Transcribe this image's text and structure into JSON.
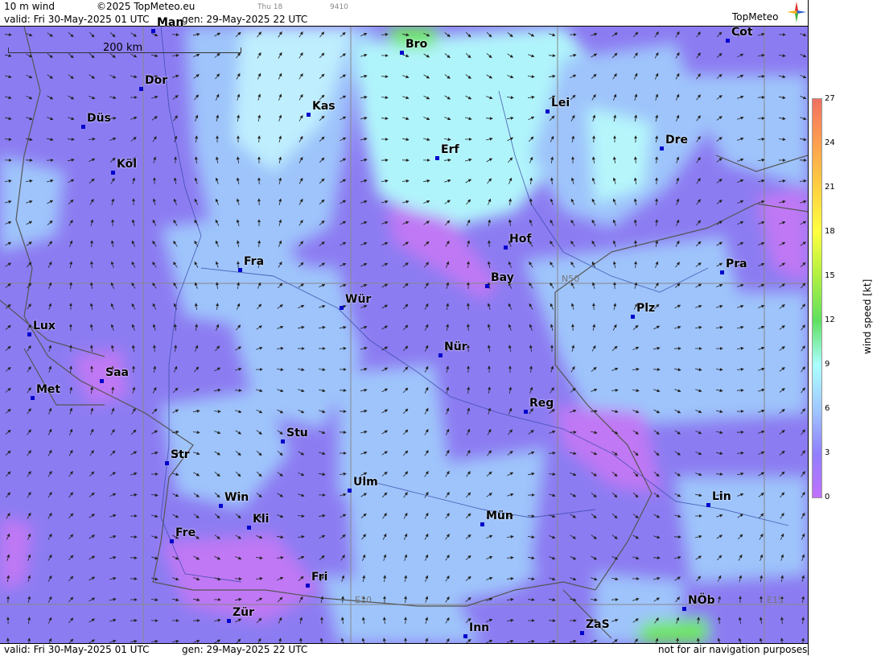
{
  "header": {
    "product": "10 m wind",
    "copyright": "©2025 TopMeteo.eu",
    "top_small_left": "Thu 18",
    "top_small_right": "9410",
    "valid_label": "valid:  Fri  30-May-2025  01 UTC",
    "gen_label": "gen: 29-May-2025 22 UTC",
    "brand": "TopMeteo"
  },
  "footer": {
    "valid_label": "valid:  Fri  30-May-2025  01 UTC",
    "gen_label": "gen: 29-May-2025 22 UTC",
    "disclaimer": "not for air navigation purposes"
  },
  "legend": {
    "title": "wind speed [kt]",
    "ticks": [
      "27",
      "24",
      "21",
      "18",
      "15",
      "12",
      "9",
      "6",
      "3",
      "0"
    ],
    "colors": [
      "#f07060",
      "#ffa050",
      "#ffd040",
      "#ffff40",
      "#b0f040",
      "#60e060",
      "#aaffff",
      "#a0c8ff",
      "#9080ff",
      "#c070ff"
    ]
  },
  "map": {
    "scale_label": "200 km",
    "grid_labels": [
      "N50",
      "E10",
      "E15"
    ],
    "cities": [
      {
        "name": "Man",
        "dot": [
          190,
          38
        ]
      },
      {
        "name": "Bro",
        "dot": [
          499,
          65
        ]
      },
      {
        "name": "Cot",
        "dot": [
          904,
          50
        ]
      },
      {
        "name": "Dor",
        "dot": [
          175,
          110
        ]
      },
      {
        "name": "Kas",
        "dot": [
          383,
          142
        ]
      },
      {
        "name": "Lei",
        "dot": [
          680,
          138
        ]
      },
      {
        "name": "Düs",
        "dot": [
          103,
          157
        ]
      },
      {
        "name": "Erf",
        "dot": [
          543,
          196
        ]
      },
      {
        "name": "Dre",
        "dot": [
          822,
          184
        ]
      },
      {
        "name": "Köl",
        "dot": [
          140,
          214
        ]
      },
      {
        "name": "Hof",
        "dot": [
          628,
          307
        ]
      },
      {
        "name": "Fra",
        "dot": [
          298,
          335
        ]
      },
      {
        "name": "Pra",
        "dot": [
          897,
          338
        ]
      },
      {
        "name": "Bay",
        "dot": [
          605,
          355
        ]
      },
      {
        "name": "Wür",
        "dot": [
          424,
          382
        ]
      },
      {
        "name": "Plz",
        "dot": [
          786,
          393
        ]
      },
      {
        "name": "Lux",
        "dot": [
          36,
          415
        ]
      },
      {
        "name": "Nür",
        "dot": [
          547,
          441
        ]
      },
      {
        "name": "Saa",
        "dot": [
          126,
          473
        ]
      },
      {
        "name": "Met",
        "dot": [
          40,
          494
        ]
      },
      {
        "name": "Reg",
        "dot": [
          653,
          511
        ]
      },
      {
        "name": "Stu",
        "dot": [
          351,
          548
        ]
      },
      {
        "name": "Str",
        "dot": [
          207,
          575
        ]
      },
      {
        "name": "Ulm",
        "dot": [
          434,
          609
        ]
      },
      {
        "name": "Lin",
        "dot": [
          880,
          627
        ]
      },
      {
        "name": "Win",
        "dot": [
          274,
          628
        ]
      },
      {
        "name": "Mün",
        "dot": [
          599,
          651
        ]
      },
      {
        "name": "Kli",
        "dot": [
          309,
          655
        ]
      },
      {
        "name": "Fre",
        "dot": [
          213,
          672
        ]
      },
      {
        "name": "Fri",
        "dot": [
          382,
          727
        ]
      },
      {
        "name": "NÖb",
        "dot": [
          850,
          756
        ]
      },
      {
        "name": "Zür",
        "dot": [
          284,
          771
        ]
      },
      {
        "name": "ZaS",
        "dot": [
          723,
          786
        ]
      },
      {
        "name": "Inn",
        "dot": [
          578,
          790
        ]
      }
    ]
  }
}
